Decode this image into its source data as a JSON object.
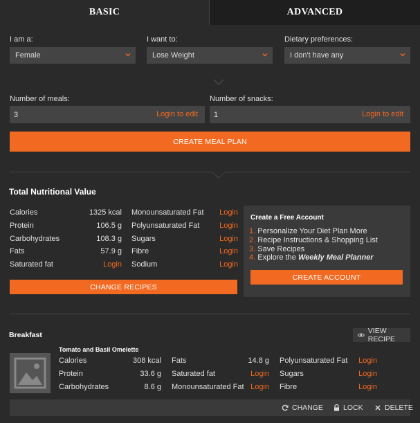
{
  "tabs": {
    "basic": "BASIC",
    "advanced": "ADVANCED"
  },
  "form": {
    "gender_label": "I am a:",
    "gender_value": "Female",
    "goal_label": "I want to:",
    "goal_value": "Lose Weight",
    "diet_label": "Dietary preferences:",
    "diet_value": "I don't have any",
    "meals_label": "Number of meals:",
    "meals_value": "3",
    "snacks_label": "Number of snacks:",
    "snacks_value": "1",
    "login_to_edit": "Login to edit",
    "create_button": "CREATE MEAL PLAN"
  },
  "nutrition": {
    "title": "Total Nutritional Value",
    "left": [
      {
        "label": "Calories",
        "value": "1325 kcal"
      },
      {
        "label": "Protein",
        "value": "106.5 g"
      },
      {
        "label": "Carbohydrates",
        "value": "108.3 g"
      },
      {
        "label": "Fats",
        "value": "57.9 g"
      },
      {
        "label": "Saturated fat",
        "value": "Login"
      }
    ],
    "right": [
      {
        "label": "Monounsaturated Fat",
        "value": "Login"
      },
      {
        "label": "Polyunsaturated Fat",
        "value": "Login"
      },
      {
        "label": "Sugars",
        "value": "Login"
      },
      {
        "label": "Fibre",
        "value": "Login"
      },
      {
        "label": "Sodium",
        "value": "Login"
      }
    ],
    "change_button": "CHANGE RECIPES"
  },
  "account": {
    "title": "Create a Free Account",
    "items": [
      {
        "n": "1.",
        "text": "Personalize Your Diet Plan More"
      },
      {
        "n": "2.",
        "text": "Recipe Instructions & Shopping List"
      },
      {
        "n": "3.",
        "text": "Save Recipes"
      },
      {
        "n": "4.",
        "text": "Explore the ",
        "em": "Weekly Meal Planner"
      }
    ],
    "button": "CREATE ACCOUNT"
  },
  "meal": {
    "section": "Breakfast",
    "view_recipe": "VIEW RECIPE",
    "recipe_name": "Tomato and Basil Omelette",
    "col1": [
      {
        "label": "Calories",
        "value": "308 kcal"
      },
      {
        "label": "Protein",
        "value": "33.6 g"
      },
      {
        "label": "Carbohydrates",
        "value": "8.6 g"
      }
    ],
    "col2": [
      {
        "label": "Fats",
        "value": "14.8 g"
      },
      {
        "label": "Saturated fat",
        "value": "Login"
      },
      {
        "label": "Monounsaturated Fat",
        "value": "Login"
      }
    ],
    "col3": [
      {
        "label": "Polyunsaturated Fat",
        "value": "Login"
      },
      {
        "label": "Sugars",
        "value": "Login"
      },
      {
        "label": "Fibre",
        "value": "Login"
      }
    ],
    "actions": {
      "change": "CHANGE",
      "lock": "LOCK",
      "delete": "DELETE"
    }
  }
}
